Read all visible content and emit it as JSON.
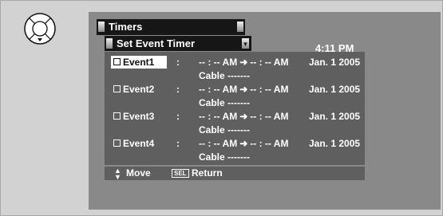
{
  "colors": {
    "screen_bg": "#898989",
    "panel_bg": "#5f5f5f",
    "bar_bg": "#161616",
    "text": "#ffffff"
  },
  "remote_icon": "dpad-select-icon",
  "menu": {
    "title": "Timers",
    "submenu": "Set Event Timer",
    "clock": "4:11 PM"
  },
  "events": [
    {
      "label": "Event1",
      "colon": ":",
      "start": "-- : -- AM",
      "end": "-- : -- AM",
      "date": "Jan. 1 2005",
      "source": "Cable  -------",
      "selected": true
    },
    {
      "label": "Event2",
      "colon": ":",
      "start": "-- : -- AM",
      "end": "-- : -- AM",
      "date": "Jan. 1 2005",
      "source": "Cable  -------",
      "selected": false
    },
    {
      "label": "Event3",
      "colon": ":",
      "start": "-- : -- AM",
      "end": "-- : -- AM",
      "date": "Jan. 1 2005",
      "source": "Cable  -------",
      "selected": false
    },
    {
      "label": "Event4",
      "colon": ":",
      "start": "-- : -- AM",
      "end": "-- : -- AM",
      "date": "Jan. 1 2005",
      "source": "Cable  -------",
      "selected": false
    }
  ],
  "footer": {
    "move": "Move",
    "sel_key": "SEL",
    "return": "Return"
  }
}
